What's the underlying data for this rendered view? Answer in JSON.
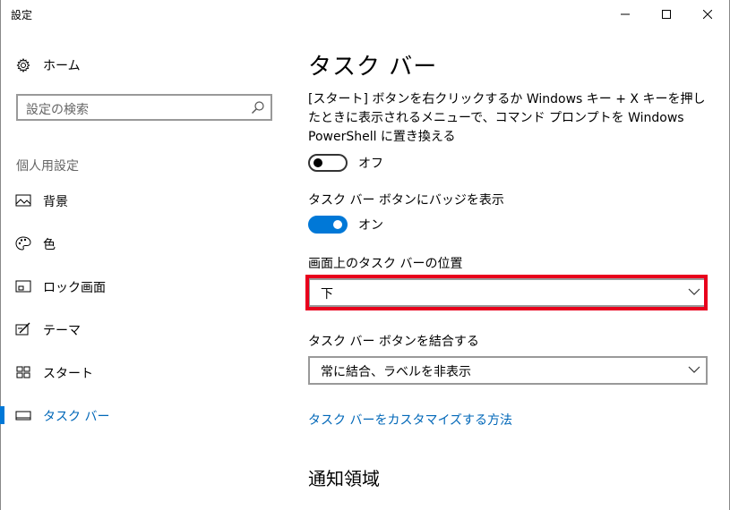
{
  "window": {
    "title": "設定"
  },
  "sidebar": {
    "home_label": "ホーム",
    "search_placeholder": "設定の検索",
    "section_label": "個人用設定",
    "items": [
      {
        "label": "背景",
        "icon": "picture-icon"
      },
      {
        "label": "色",
        "icon": "palette-icon"
      },
      {
        "label": "ロック画面",
        "icon": "lock-screen-icon"
      },
      {
        "label": "テーマ",
        "icon": "theme-icon"
      },
      {
        "label": "スタート",
        "icon": "start-icon"
      },
      {
        "label": "タスク バー",
        "icon": "taskbar-icon",
        "active": true
      }
    ]
  },
  "main": {
    "title": "タスク バー",
    "powershell_desc": "[スタート] ボタンを右クリックするか Windows キー + X キーを押したときに表示されるメニューで、コマンド プロンプトを Windows PowerShell に置き換える",
    "powershell_toggle": {
      "state": "off",
      "label": "オフ"
    },
    "badges_label": "タスク バー ボタンにバッジを表示",
    "badges_toggle": {
      "state": "on",
      "label": "オン"
    },
    "position_label": "画面上のタスク バーの位置",
    "position_value": "下",
    "combine_label": "タスク バー ボタンを結合する",
    "combine_value": "常に結合、ラベルを非表示",
    "customize_link": "タスク バーをカスタマイズする方法",
    "notification_title": "通知領域"
  },
  "colors": {
    "accent": "#0078d7",
    "link": "#0067b8",
    "highlight": "#e8001c"
  }
}
